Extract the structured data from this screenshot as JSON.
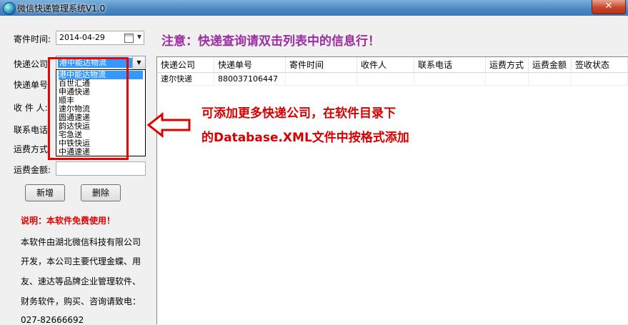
{
  "window": {
    "title": "微信快递管理系统V1.0",
    "close": "✕"
  },
  "form": {
    "send_time_label": "寄件时间:",
    "send_time_value": "2014-04-29",
    "courier_label": "快递公司:",
    "courier_selected": "港中能达物流",
    "tracking_label": "快递单号:",
    "receiver_label": "收 件 人:",
    "phone_label": "联系电话:",
    "shipping_label": "运费方式:",
    "fee_label": "运费金额:"
  },
  "dropdown_options": [
    "港中能达物流",
    "百世汇通",
    "申通快递",
    "顺丰",
    "速尔物流",
    "圆通速递",
    "韵达快运",
    "宅急送",
    "中铁快运",
    "中通速递"
  ],
  "buttons": {
    "add": "新增",
    "delete": "删除"
  },
  "note": {
    "title": "说明：本软件免费使用！",
    "lines": [
      "本软件由湖北微信科技有限公司",
      "开发，本公司主要代理金蝶、用",
      "友、速达等品牌企业管理软件、",
      "财务软件，购买、咨询请致电：",
      "027-82666692"
    ]
  },
  "notice": "注意：快递查询请双击列表中的信息行！",
  "table": {
    "columns": [
      "快递公司",
      "快递单号",
      "寄件时间",
      "收件人",
      "联系电话",
      "运费方式",
      "运费金额",
      "签收状态"
    ],
    "rows": [
      [
        "速尔快递",
        "880037106447",
        "",
        "",
        "",
        "",
        "",
        ""
      ]
    ]
  },
  "tip": {
    "line1": "可添加更多快递公司，在软件目录下",
    "line2": "的Database.XML文件中按格式添加"
  },
  "colors": {
    "tip": "#d40000",
    "notice": "#9b2fa0",
    "highlight_box": "#e00000",
    "selection": "#3399ff"
  }
}
